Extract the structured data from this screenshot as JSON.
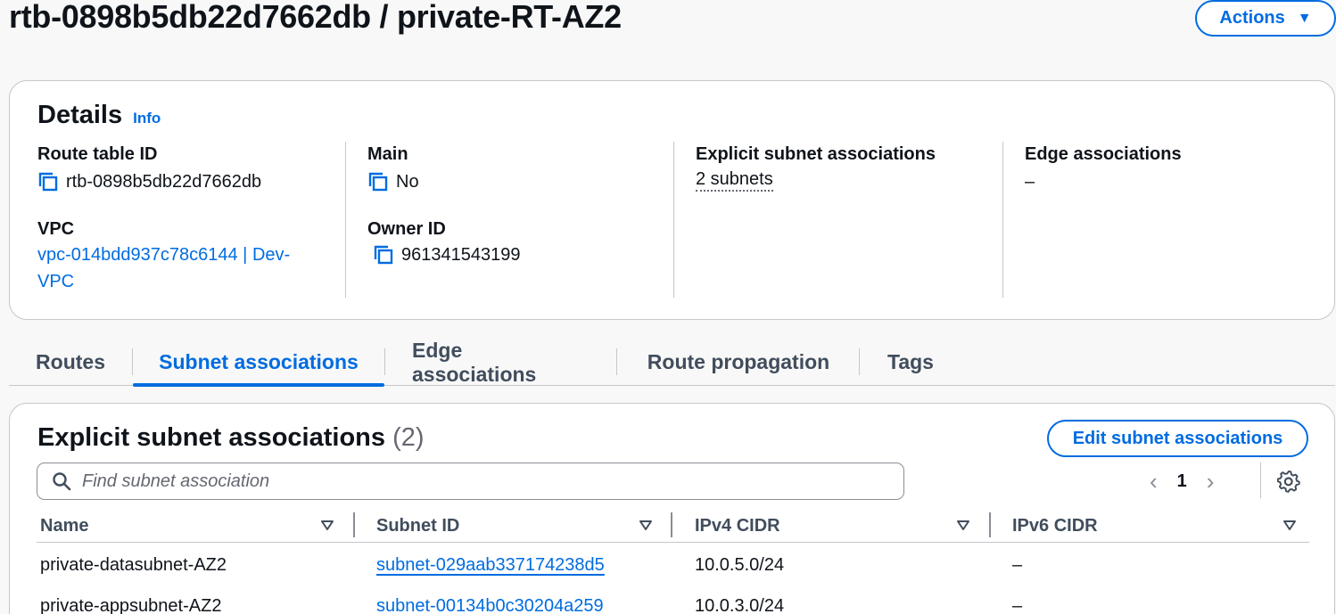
{
  "header": {
    "title": "rtb-0898b5db22d7662db / private-RT-AZ2",
    "actions_label": "Actions"
  },
  "details": {
    "title": "Details",
    "info_label": "Info",
    "route_table_id": {
      "label": "Route table ID",
      "value": "rtb-0898b5db22d7662db"
    },
    "main": {
      "label": "Main",
      "value": "No"
    },
    "explicit_subnet_associations": {
      "label": "Explicit subnet associations",
      "value": "2 subnets"
    },
    "edge_associations": {
      "label": "Edge associations",
      "value": "–"
    },
    "vpc": {
      "label": "VPC",
      "value_line1": "vpc-014bdd937c78c6144 | Dev-",
      "value_line2": "VPC"
    },
    "owner_id": {
      "label": "Owner ID",
      "value": "961341543199"
    }
  },
  "tabs": [
    {
      "label": "Routes",
      "active": false
    },
    {
      "label": "Subnet associations",
      "active": true
    },
    {
      "label": "Edge associations",
      "active": false
    },
    {
      "label": "Route propagation",
      "active": false
    },
    {
      "label": "Tags",
      "active": false
    }
  ],
  "associations": {
    "title": "Explicit subnet associations",
    "count": "(2)",
    "edit_label": "Edit subnet associations",
    "search_placeholder": "Find subnet association",
    "current_page": "1",
    "columns": [
      "Name",
      "Subnet ID",
      "IPv4 CIDR",
      "IPv6 CIDR"
    ],
    "rows": [
      {
        "name": "private-datasubnet-AZ2",
        "subnet_id": "subnet-029aab337174238d5",
        "ipv4": "10.0.5.0/24",
        "ipv6": "–"
      },
      {
        "name": "private-appsubnet-AZ2",
        "subnet_id": "subnet-00134b0c30204a259",
        "ipv4": "10.0.3.0/24",
        "ipv6": "–"
      }
    ]
  },
  "colors": {
    "accent": "#006ce0",
    "text": "#0f141a",
    "muted": "#656871",
    "border": "#c6c6cd"
  },
  "icons": [
    "copy-icon",
    "caret-down-icon",
    "search-icon",
    "chevron-left-icon",
    "chevron-right-icon",
    "gear-icon",
    "sort-down-icon"
  ]
}
